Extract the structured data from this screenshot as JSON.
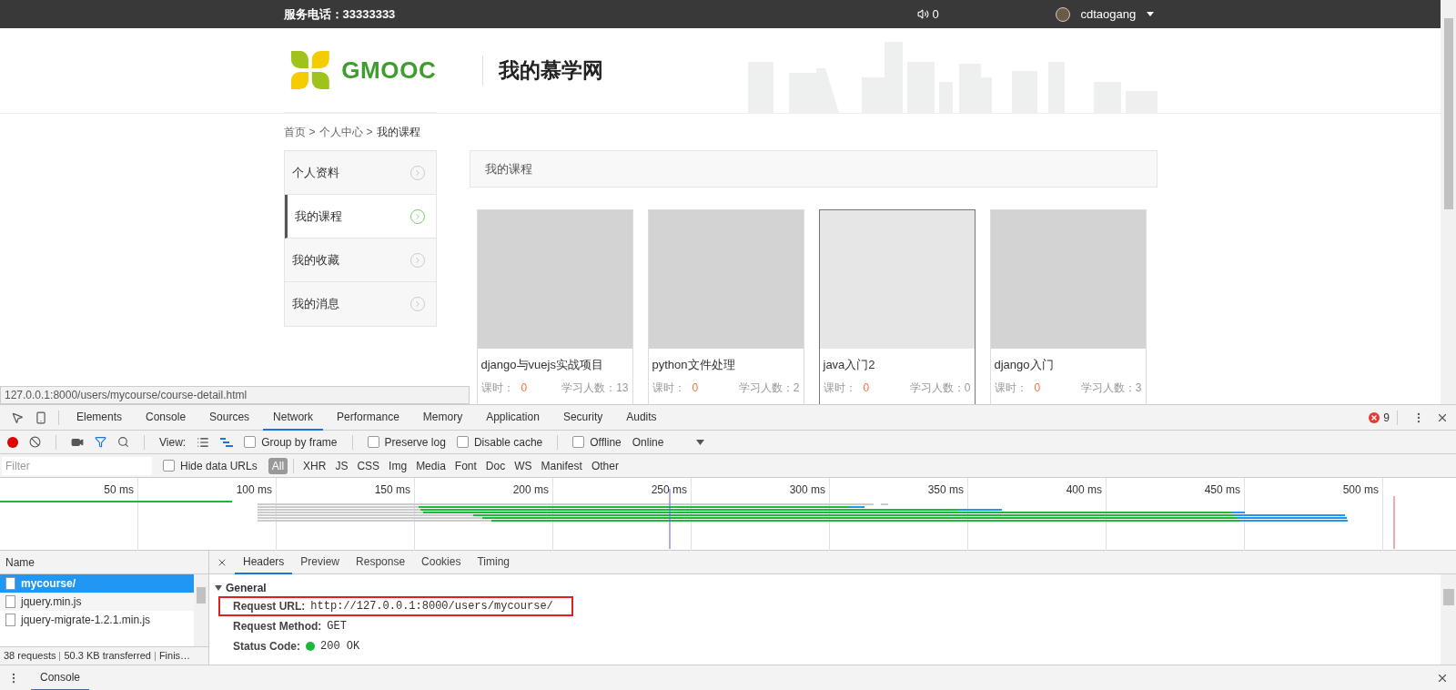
{
  "top_bar": {
    "phone_label": "服务电话：",
    "phone": "33333333",
    "messages": "0",
    "username": "cdtaogang"
  },
  "header": {
    "logo_text": "GMOOC",
    "title": "我的慕学网"
  },
  "breadcrumb": {
    "items": [
      "首页",
      "个人中心",
      "我的课程"
    ],
    "separator": ">"
  },
  "sidebar": [
    {
      "label": "个人资料",
      "selected": false
    },
    {
      "label": "我的课程",
      "selected": true
    },
    {
      "label": "我的收藏",
      "selected": false
    },
    {
      "label": "我的消息",
      "selected": false
    }
  ],
  "content": {
    "title": "我的课程",
    "courses": [
      {
        "name": "django与vuejs实战项目",
        "hours_label": "课时：",
        "hours": "0",
        "students_label": "学习人数：",
        "students": "13",
        "hovered": false
      },
      {
        "name": "python文件处理",
        "hours_label": "课时：",
        "hours": "0",
        "students_label": "学习人数：",
        "students": "2",
        "hovered": false
      },
      {
        "name": "java入门2",
        "hours_label": "课时：",
        "hours": "0",
        "students_label": "学习人数：",
        "students": "0",
        "hovered": true
      },
      {
        "name": "django入门",
        "hours_label": "课时：",
        "hours": "0",
        "students_label": "学习人数：",
        "students": "3",
        "hovered": false
      }
    ]
  },
  "status_url": "127.0.0.1:8000/users/mycourse/course-detail.html",
  "devtools": {
    "tabs": [
      {
        "label": "Elements",
        "selected": false
      },
      {
        "label": "Console",
        "selected": false
      },
      {
        "label": "Sources",
        "selected": false
      },
      {
        "label": "Network",
        "selected": true
      },
      {
        "label": "Performance",
        "selected": false
      },
      {
        "label": "Memory",
        "selected": false
      },
      {
        "label": "Application",
        "selected": false
      },
      {
        "label": "Security",
        "selected": false
      },
      {
        "label": "Audits",
        "selected": false
      }
    ],
    "error_count": "9",
    "toolbar": {
      "recording": true,
      "view_label": "View:",
      "group_by_frame": {
        "label": "Group by frame",
        "checked": false
      },
      "preserve_log": {
        "label": "Preserve log",
        "checked": false
      },
      "disable_cache": {
        "label": "Disable cache",
        "checked": false
      },
      "offline": {
        "label": "Offline",
        "checked": false
      },
      "throttling": "Online"
    },
    "filter": {
      "placeholder": "Filter",
      "hide_data_urls": {
        "label": "Hide data URLs",
        "checked": false
      },
      "types": [
        {
          "label": "All",
          "selected": true
        },
        {
          "label": "XHR",
          "selected": false
        },
        {
          "label": "JS",
          "selected": false
        },
        {
          "label": "CSS",
          "selected": false
        },
        {
          "label": "Img",
          "selected": false
        },
        {
          "label": "Media",
          "selected": false
        },
        {
          "label": "Font",
          "selected": false
        },
        {
          "label": "Doc",
          "selected": false
        },
        {
          "label": "WS",
          "selected": false
        },
        {
          "label": "Manifest",
          "selected": false
        },
        {
          "label": "Other",
          "selected": false
        }
      ]
    },
    "timeline_ticks": [
      "50 ms",
      "100 ms",
      "150 ms",
      "200 ms",
      "250 ms",
      "300 ms",
      "350 ms",
      "400 ms",
      "450 ms",
      "500 ms"
    ],
    "requests": {
      "column": "Name",
      "rows": [
        {
          "name": "mycourse/",
          "selected": true
        },
        {
          "name": "jquery.min.js",
          "selected": false
        },
        {
          "name": "jquery-migrate-1.2.1.min.js",
          "selected": false
        }
      ],
      "summary": [
        "38 requests",
        "50.3 KB transferred",
        "Finis…"
      ]
    },
    "detail": {
      "tabs": [
        {
          "label": "Headers",
          "selected": true
        },
        {
          "label": "Preview",
          "selected": false
        },
        {
          "label": "Response",
          "selected": false
        },
        {
          "label": "Cookies",
          "selected": false
        },
        {
          "label": "Timing",
          "selected": false
        }
      ],
      "section": {
        "title": "General",
        "expanded": true,
        "rows": [
          {
            "key": "Request URL:",
            "value": "http://127.0.0.1:8000/users/mycourse/",
            "highlighted": true,
            "kind": "text"
          },
          {
            "key": "Request Method:",
            "value": "GET",
            "highlighted": false,
            "kind": "text"
          },
          {
            "key": "Status Code:",
            "value": "200 OK",
            "highlighted": false,
            "kind": "status"
          }
        ]
      }
    },
    "drawer": {
      "tab": "Console"
    }
  }
}
